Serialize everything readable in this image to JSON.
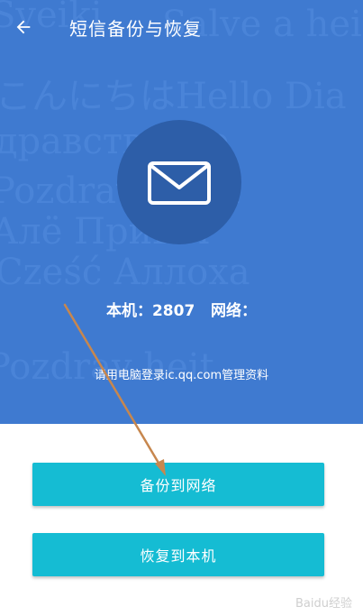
{
  "header": {
    "title": "短信备份与恢复"
  },
  "status": {
    "local_label": "本机",
    "local_count": "2807",
    "network_label": "网络",
    "network_count": ""
  },
  "hint": "请用电脑登录ic.qq.com管理资料",
  "actions": {
    "backup_label": "备份到网络",
    "restore_label": "恢复到本机"
  },
  "watermark": "Baidu经验",
  "background_words": [
    "Sveiki",
    "Salve a heit",
    "こんにちはHello Dia",
    "Здравствуйте",
    "Pozdrav heita",
    "Алё Привет",
    "Cześć Аллоха",
    "Pozdrav heit"
  ],
  "colors": {
    "hero": "#3f7ad0",
    "circle": "#2d5ea8",
    "button": "#15bcd3",
    "annotation_arrow": "#c7874e"
  },
  "icons": {
    "back": "arrow-left-icon",
    "mail": "envelope-icon"
  }
}
